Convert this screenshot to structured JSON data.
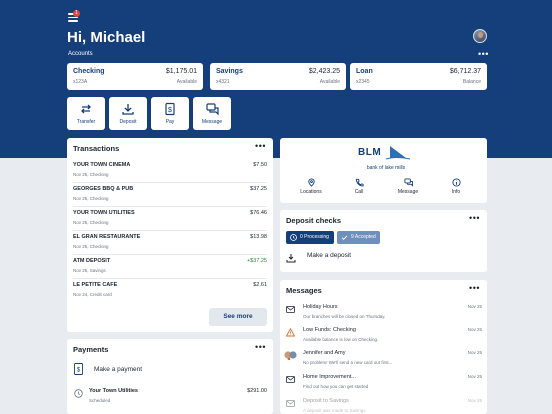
{
  "header": {
    "menu_badge": "1",
    "greeting": "Hi, Michael",
    "accounts_label": "Accounts",
    "more_label": "•••"
  },
  "accounts": [
    {
      "name": "Checking",
      "number": "x123A",
      "amount": "$1,175.01",
      "sub": "Available"
    },
    {
      "name": "Savings",
      "number": "x4321",
      "amount": "$2,423.25",
      "sub": "Available"
    },
    {
      "name": "Loan",
      "number": "x2345",
      "amount": "$6,712.37",
      "sub": "Balance"
    }
  ],
  "quick_actions": [
    {
      "label": "Transfer",
      "icon": "transfer-icon"
    },
    {
      "label": "Deposit",
      "icon": "deposit-icon"
    },
    {
      "label": "Pay",
      "icon": "pay-icon"
    },
    {
      "label": "Message",
      "icon": "message-icon"
    }
  ],
  "transactions": {
    "title": "Transactions",
    "more": "•••",
    "items": [
      {
        "name": "YOUR TOWN CINEMA",
        "detail": "Nov 25, Checking",
        "amount": "$7.50",
        "positive": false
      },
      {
        "name": "GEORGES BBQ & PUB",
        "detail": "Nov 25, Checking",
        "amount": "$37.25",
        "positive": false
      },
      {
        "name": "YOUR TOWN UTILITIES",
        "detail": "Nov 25, Checking",
        "amount": "$76.46",
        "positive": false
      },
      {
        "name": "EL GRAN RESTAURANTE",
        "detail": "Nov 25, Checking",
        "amount": "$13.98",
        "positive": false
      },
      {
        "name": "ATM DEPOSIT",
        "detail": "Nov 25, Savings",
        "amount": "+$37.25",
        "positive": true
      },
      {
        "name": "LE PETITE CAFE",
        "detail": "Nov 24, Credit card",
        "amount": "$2.61",
        "positive": false
      }
    ],
    "see_more": "See more"
  },
  "bank": {
    "logo_text": "BLM",
    "name": "bank of lake mills",
    "links": [
      {
        "label": "Locations",
        "icon": "location-pin-icon"
      },
      {
        "label": "Call",
        "icon": "phone-icon"
      },
      {
        "label": "Message",
        "icon": "chat-icon"
      },
      {
        "label": "Info",
        "icon": "info-icon"
      }
    ]
  },
  "deposit_checks": {
    "title": "Deposit checks",
    "more": "•••",
    "processing": "0 Processing",
    "accepted": "9 Accepted",
    "make_deposit": "Make a deposit"
  },
  "messages": {
    "title": "Messages",
    "more": "•••",
    "items": [
      {
        "title": "Holiday Hours",
        "preview": "Our branches will be closed on Thursday.",
        "date": "Nov 25",
        "icon": "envelope-icon"
      },
      {
        "title": "Low Funds: Checking",
        "preview": "Available balance is low on Checking.",
        "date": "Nov 25",
        "icon": "warning-icon"
      },
      {
        "title": "Jennifer and Amy",
        "preview": "No problem! We'll send a new card out first...",
        "date": "Nov 25",
        "icon": "avatars-icon"
      },
      {
        "title": "Home Improvement...",
        "preview": "Find out how you can get started",
        "date": "Nov 25",
        "icon": "envelope-icon"
      },
      {
        "title": "Deposit to Savings",
        "preview": "A deposit was made to Savings",
        "date": "Nov 25",
        "icon": "envelope-icon"
      }
    ]
  },
  "payments": {
    "title": "Payments",
    "more": "•••",
    "make_payment": "Make a payment",
    "items": [
      {
        "payee": "Your Town Utilities",
        "status": "Scheduled",
        "amount": "$291.00"
      }
    ]
  },
  "colors": {
    "brand_navy": "#153f7a",
    "processing_pill": "#153f7a",
    "accepted_pill": "#6f8fbf",
    "positive_amount": "#2e8b3a",
    "warning": "#e06a2b",
    "badge": "#e0463a"
  }
}
